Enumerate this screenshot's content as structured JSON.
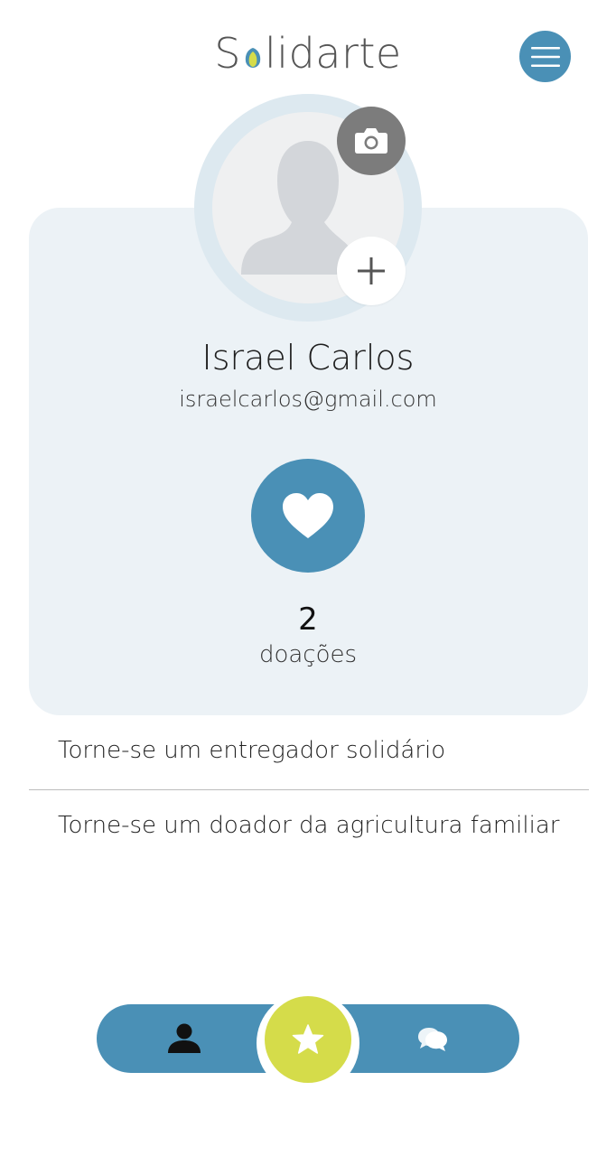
{
  "header": {
    "logo_prefix": "S",
    "logo_suffix": "lidarte",
    "menu_icon": "hamburger-menu-icon"
  },
  "profile": {
    "name": "Israel Carlos",
    "email": "israelcarlos@gmail.com",
    "camera_icon": "camera-icon",
    "add_icon": "plus-icon"
  },
  "stats": {
    "donations_count": "2",
    "donations_label": "doações"
  },
  "options": [
    {
      "label": "Torne-se um entregador solidário"
    },
    {
      "label": "Torne-se um doador da agricultura familiar"
    }
  ],
  "bottom_nav": {
    "items": [
      {
        "icon": "user-icon",
        "active": false
      },
      {
        "icon": "star-icon",
        "active": true
      },
      {
        "icon": "chat-bubbles-icon",
        "active": false
      }
    ]
  },
  "colors": {
    "primary_blue": "#4a90b6",
    "accent_lime": "#d5dc4a",
    "card_background": "#ecf2f6",
    "camera_gray": "#7c7c7c"
  }
}
